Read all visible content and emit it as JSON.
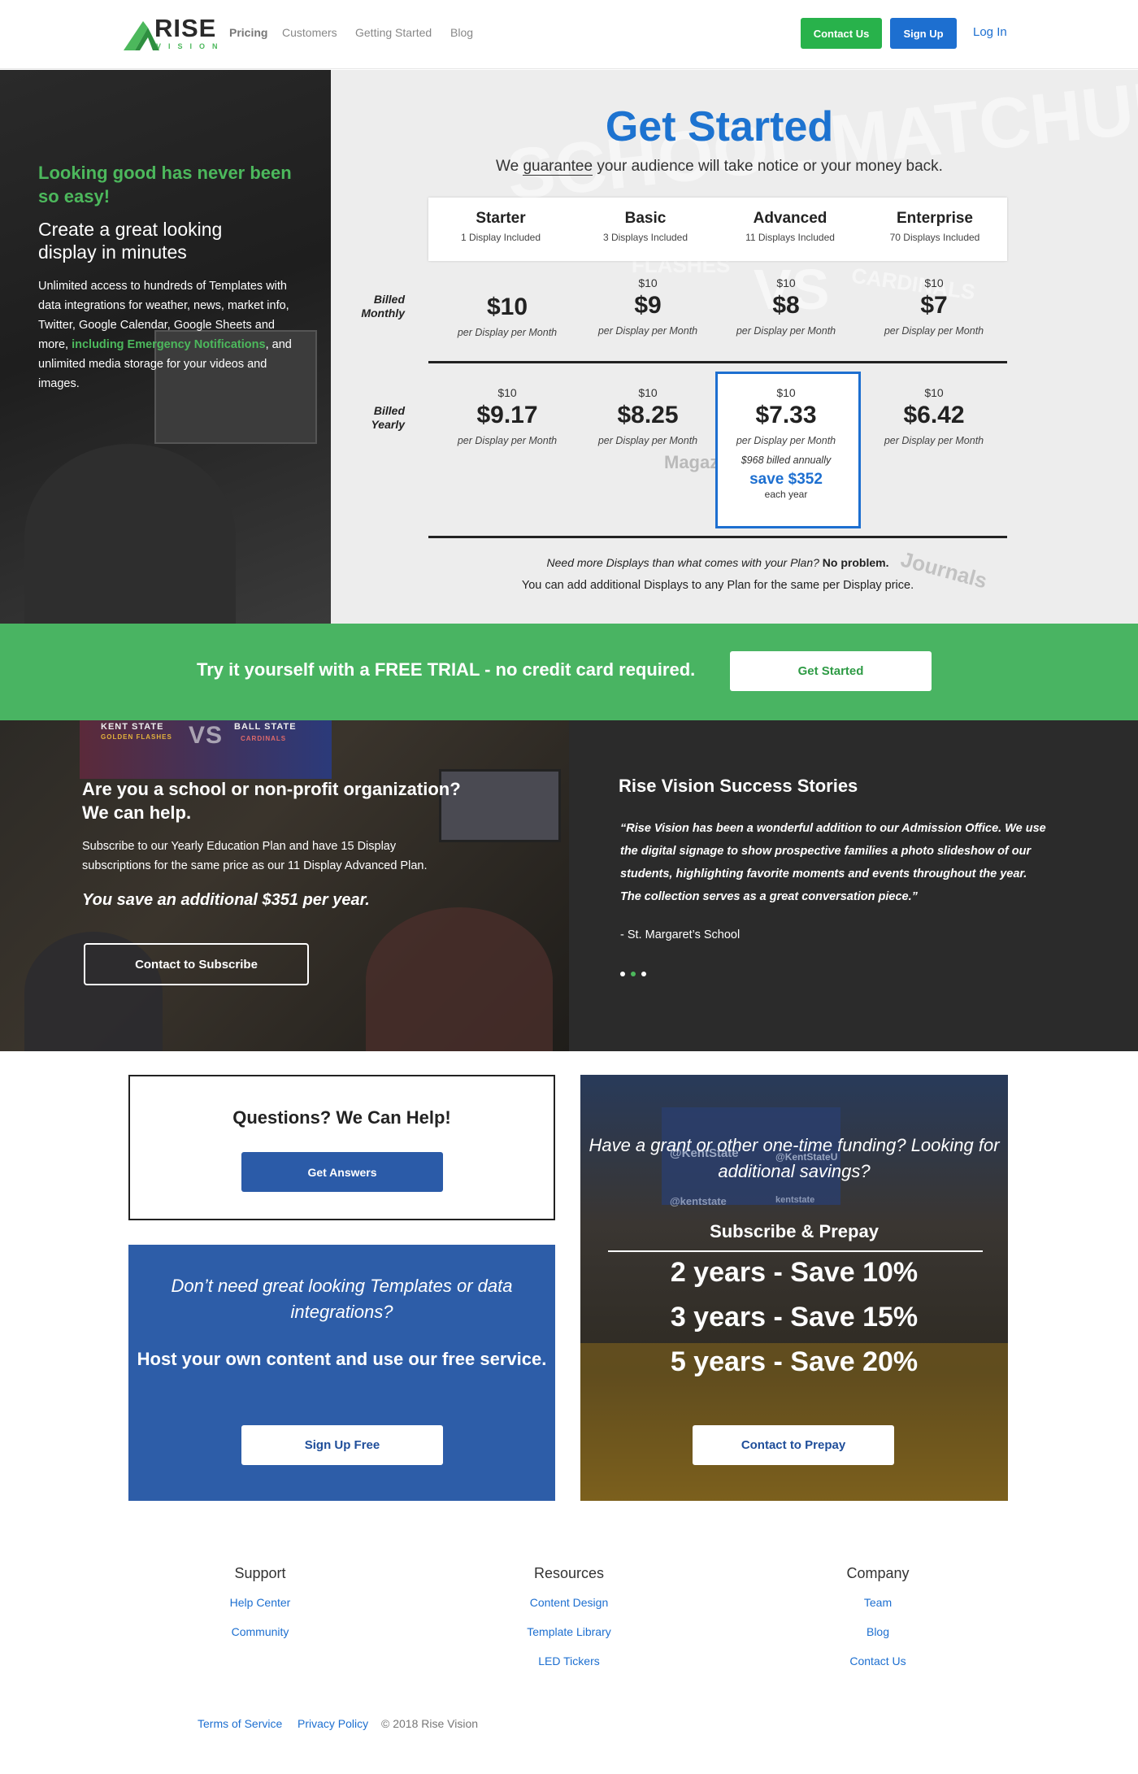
{
  "header": {
    "logo_word": "RISE",
    "logo_sub": "VISION",
    "nav": [
      "Pricing",
      "Customers",
      "Getting Started",
      "Blog"
    ],
    "contact": "Contact Us",
    "signup": "Sign Up",
    "login": "Log In",
    "colors": {
      "green": "#28b24b",
      "blue": "#1d6fd0"
    }
  },
  "hero": {
    "left_headline": "Looking good has never been so easy!",
    "left_sub": "Create a great looking display in minutes",
    "left_body_1": "Unlimited access to hundreds of Templates with data integrations for weather, news, market info, Twitter, Google Calendar, Google Sheets and more, ",
    "left_body_highlight": "including Emergency Notifications",
    "left_body_2": ", and unlimited media storage for your videos and images.",
    "title": "Get Started",
    "subtitle_pre": "We ",
    "subtitle_u": "guarantee",
    "subtitle_post": " your audience will take notice or your money back.",
    "bg_words": [
      "SCHOOL MATCHUP",
      "VS",
      "FLASHES",
      "CARDINALS",
      "Magazine",
      "Journals"
    ],
    "plans": [
      {
        "name": "Starter",
        "included": "1 Display Included"
      },
      {
        "name": "Basic",
        "included": "3 Displays Included"
      },
      {
        "name": "Advanced",
        "included": "11 Displays Included"
      },
      {
        "name": "Enterprise",
        "included": "70 Displays Included"
      }
    ],
    "billed_monthly": [
      "Billed",
      "Monthly"
    ],
    "billed_yearly": [
      "Billed",
      "Yearly"
    ],
    "monthly": [
      {
        "old": "",
        "price": "$10",
        "per": "per Display per Month"
      },
      {
        "old": "$10",
        "price": "$9",
        "per": "per Display per Month"
      },
      {
        "old": "$10",
        "price": "$8",
        "per": "per Display per Month"
      },
      {
        "old": "$10",
        "price": "$7",
        "per": "per Display per Month"
      }
    ],
    "yearly": [
      {
        "old": "$10",
        "price": "$9.17",
        "per": "per Display per Month"
      },
      {
        "old": "$10",
        "price": "$8.25",
        "per": "per Display per Month"
      },
      {
        "old": "$10",
        "price": "$7.33",
        "per": "per Display per Month"
      },
      {
        "old": "$10",
        "price": "$6.42",
        "per": "per Display per Month"
      }
    ],
    "advanced_annual": "$968 billed annually",
    "advanced_save": "save $352",
    "advanced_each": "each year",
    "more_q": "Need more Displays than what comes with your Plan? ",
    "more_q_bold": "No problem.",
    "more_a": "You can add additional Displays to any Plan for the same per Display price."
  },
  "trial": {
    "text": "Try it yourself with a FREE TRIAL - no credit card required.",
    "button": "Get Started"
  },
  "school": {
    "tv_left": "KENT STATE",
    "tv_left_sub": "GOLDEN FLASHES",
    "tv_vs": "VS",
    "tv_right": "BALL STATE",
    "tv_right_sub": "CARDINALS",
    "heading": "Are you a school or non-profit organization? We can help.",
    "body": "Subscribe to our Yearly Education Plan and have 15 Display subscriptions for the same price as our 11 Display Advanced Plan.",
    "save": "You save an additional $351 per year.",
    "button": "Contact to Subscribe"
  },
  "stories": {
    "heading": "Rise Vision Success Stories",
    "quote": "“Rise Vision has been a wonderful addition to our Admission Office. We use the digital signage to show prospective families a photo slideshow of our students, highlighting favorite moments and events throughout the year. The collection serves as a great conversation piece.”",
    "author": "- St. Margaret’s School",
    "active_dot": 1
  },
  "questions": {
    "heading": "Questions? We Can Help!",
    "button": "Get Answers"
  },
  "host": {
    "italic": "Don’t need great looking Templates or data integrations?",
    "bold": "Host your own content and use our free service.",
    "button": "Sign Up Free"
  },
  "grant": {
    "bg_text": [
      "@KentState",
      "@KentStateU",
      "@kentstate",
      "kentstate"
    ],
    "italic": "Have a grant or other one-time funding? Looking for additional savings?",
    "subhead": "Subscribe & Prepay",
    "years": [
      "2 years - Save 10%",
      "3 years - Save 15%",
      "5 years - Save 20%"
    ],
    "button": "Contact to Prepay"
  },
  "footer": {
    "support": {
      "title": "Support",
      "links": [
        "Help Center",
        "Community"
      ]
    },
    "resources": {
      "title": "Resources",
      "links": [
        "Content Design",
        "Template Library",
        "LED Tickers"
      ]
    },
    "company": {
      "title": "Company",
      "links": [
        "Team",
        "Blog",
        "Contact Us"
      ]
    },
    "terms": "Terms of Service",
    "privacy": "Privacy Policy",
    "copyright": "© 2018 Rise Vision"
  }
}
